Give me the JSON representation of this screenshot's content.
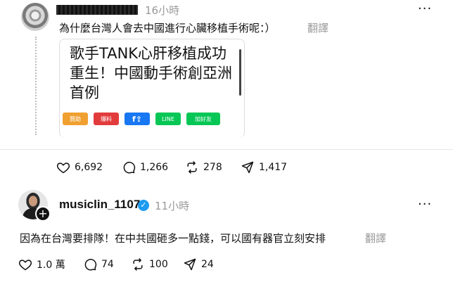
{
  "post1": {
    "time": "16小時",
    "more": "···",
    "text": "為什麼台灣人會去中國進行心臟移植手術呢：）",
    "translate": "翻譯",
    "card": {
      "title": "歌手TANK心肝移植成功重生！中國動手術創亞洲首例",
      "share_buttons": [
        {
          "label": "贊助",
          "color": "#f0a030"
        },
        {
          "label": "爆料",
          "color": "#e23b3b"
        },
        {
          "label": "f",
          "color": "#1877f2"
        },
        {
          "label": "LINE",
          "color": "#06c755"
        },
        {
          "label": "加好友",
          "color": "#06c755"
        }
      ]
    },
    "actions": {
      "likes": "6,692",
      "comments": "1,266",
      "reposts": "278",
      "shares": "1,417"
    }
  },
  "post2": {
    "username": "musiclin_1107",
    "time": "11小時",
    "more": "···",
    "text": "因為在台灣要排隊！在中共國砸多一點錢，可以國有器官立刻安排",
    "translate": "翻譯",
    "actions": {
      "likes": "1.0 萬",
      "comments": "74",
      "reposts": "100",
      "shares": "24"
    }
  },
  "icons": {
    "like": "heart-icon",
    "comment": "comment-bubble-icon",
    "repost": "repost-icon",
    "share": "send-icon",
    "verified": "verified-badge-icon",
    "follow": "plus-icon"
  },
  "colors": {
    "accent_verified": "#1d9bf0",
    "muted_text": "#999999"
  }
}
